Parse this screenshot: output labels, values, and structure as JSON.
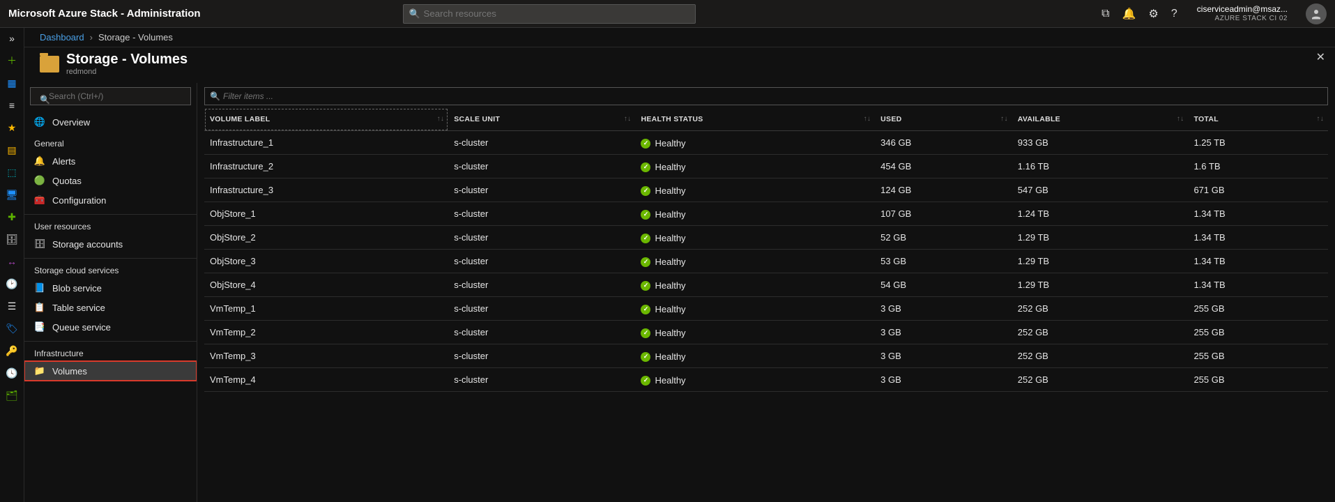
{
  "topbar": {
    "title": "Microsoft Azure Stack - Administration",
    "search_placeholder": "Search resources",
    "user_name": "ciserviceadmin@msaz...",
    "tenant": "AZURE STACK CI 02"
  },
  "breadcrumb": {
    "root": "Dashboard",
    "current": "Storage - Volumes"
  },
  "blade": {
    "title": "Storage - Volumes",
    "subtitle": "redmond"
  },
  "leftnav": {
    "search_placeholder": "Search (Ctrl+/)",
    "overview": "Overview",
    "sections": [
      {
        "title": "General",
        "items": [
          {
            "icon": "🔔",
            "label": "Alerts"
          },
          {
            "icon": "🟢",
            "label": "Quotas"
          },
          {
            "icon": "🧰",
            "label": "Configuration"
          }
        ]
      },
      {
        "title": "User resources",
        "items": [
          {
            "icon": "🗄",
            "label": "Storage accounts"
          }
        ]
      },
      {
        "title": "Storage cloud services",
        "items": [
          {
            "icon": "📘",
            "label": "Blob service"
          },
          {
            "icon": "📋",
            "label": "Table service"
          },
          {
            "icon": "📑",
            "label": "Queue service"
          }
        ]
      },
      {
        "title": "Infrastructure",
        "items": [
          {
            "icon": "📁",
            "label": "Volumes",
            "active": true
          }
        ]
      }
    ]
  },
  "grid": {
    "filter_placeholder": "Filter items ...",
    "columns": {
      "c0": "VOLUME LABEL",
      "c1": "SCALE UNIT",
      "c2": "HEALTH STATUS",
      "c3": "USED",
      "c4": "AVAILABLE",
      "c5": "TOTAL"
    },
    "rows": [
      {
        "label": "Infrastructure_1",
        "unit": "s-cluster",
        "health": "Healthy",
        "used": "346 GB",
        "avail": "933 GB",
        "total": "1.25 TB"
      },
      {
        "label": "Infrastructure_2",
        "unit": "s-cluster",
        "health": "Healthy",
        "used": "454 GB",
        "avail": "1.16 TB",
        "total": "1.6 TB"
      },
      {
        "label": "Infrastructure_3",
        "unit": "s-cluster",
        "health": "Healthy",
        "used": "124 GB",
        "avail": "547 GB",
        "total": "671 GB"
      },
      {
        "label": "ObjStore_1",
        "unit": "s-cluster",
        "health": "Healthy",
        "used": "107 GB",
        "avail": "1.24 TB",
        "total": "1.34 TB"
      },
      {
        "label": "ObjStore_2",
        "unit": "s-cluster",
        "health": "Healthy",
        "used": "52 GB",
        "avail": "1.29 TB",
        "total": "1.34 TB"
      },
      {
        "label": "ObjStore_3",
        "unit": "s-cluster",
        "health": "Healthy",
        "used": "53 GB",
        "avail": "1.29 TB",
        "total": "1.34 TB"
      },
      {
        "label": "ObjStore_4",
        "unit": "s-cluster",
        "health": "Healthy",
        "used": "54 GB",
        "avail": "1.29 TB",
        "total": "1.34 TB"
      },
      {
        "label": "VmTemp_1",
        "unit": "s-cluster",
        "health": "Healthy",
        "used": "3 GB",
        "avail": "252 GB",
        "total": "255 GB"
      },
      {
        "label": "VmTemp_2",
        "unit": "s-cluster",
        "health": "Healthy",
        "used": "3 GB",
        "avail": "252 GB",
        "total": "255 GB"
      },
      {
        "label": "VmTemp_3",
        "unit": "s-cluster",
        "health": "Healthy",
        "used": "3 GB",
        "avail": "252 GB",
        "total": "255 GB"
      },
      {
        "label": "VmTemp_4",
        "unit": "s-cluster",
        "health": "Healthy",
        "used": "3 GB",
        "avail": "252 GB",
        "total": "255 GB"
      }
    ]
  }
}
